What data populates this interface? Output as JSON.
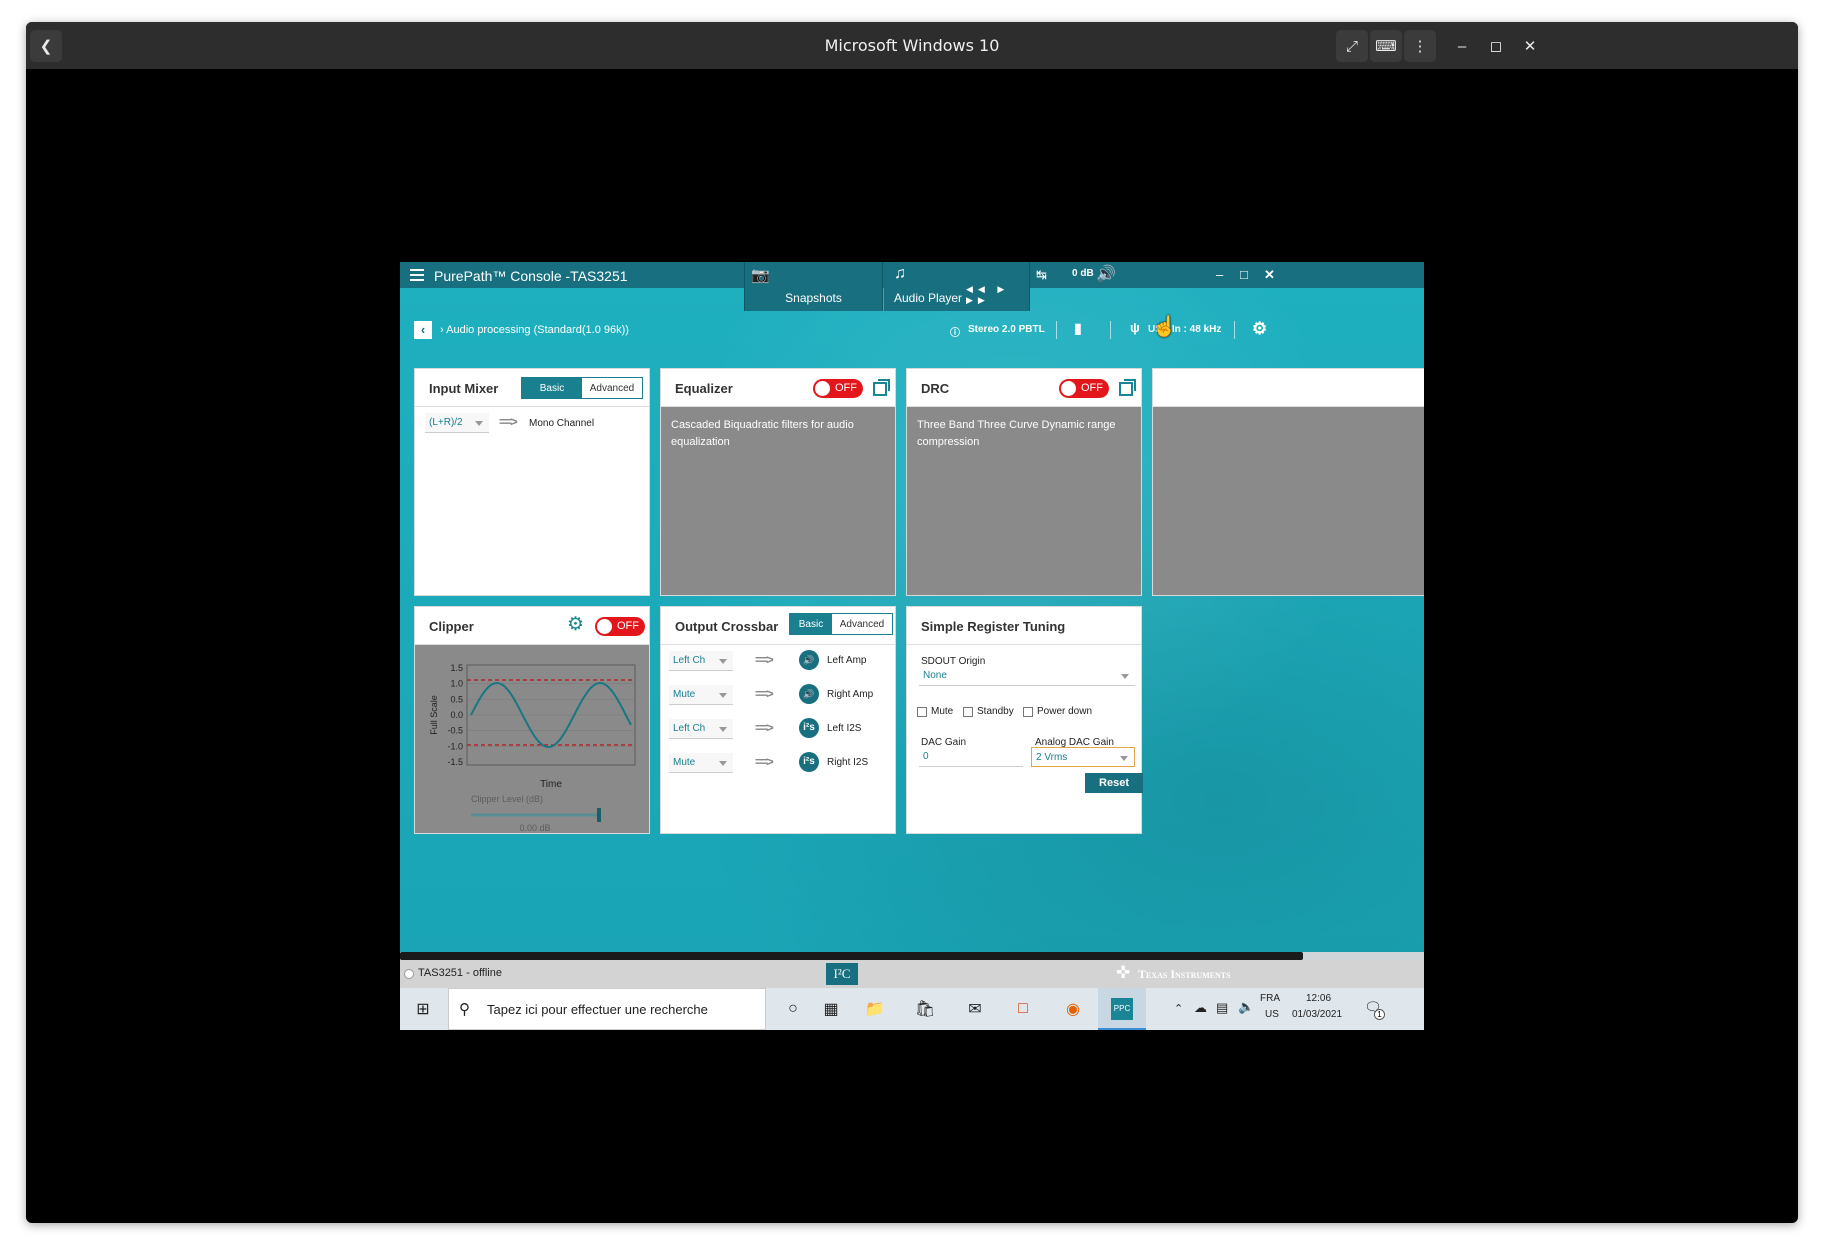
{
  "vm": {
    "title": "Microsoft Windows 10"
  },
  "app": {
    "title": "PurePath™ Console -TAS3251",
    "tabs": {
      "snapshots": "Snapshots",
      "audio_player": "Audio Player"
    },
    "volume": "0 dB",
    "breadcrumb": "Audio processing (Standard(1.0 96k))",
    "status": {
      "mode": "Stereo 2.0 PBTL",
      "usb": "USB In : 48 kHz"
    }
  },
  "input_mixer": {
    "title": "Input Mixer",
    "seg_basic": "Basic",
    "seg_advanced": "Advanced",
    "source": "(L+R)/2",
    "dest": "Mono Channel"
  },
  "equalizer": {
    "title": "Equalizer",
    "toggle": "OFF",
    "description": "Cascaded Biquadratic filters for audio equalization"
  },
  "drc": {
    "title": "DRC",
    "toggle": "OFF",
    "description": "Three Band Three Curve Dynamic range compression"
  },
  "clipper": {
    "title": "Clipper",
    "toggle": "OFF",
    "ylabel": "Full Scale",
    "xlabel": "Time",
    "yticks": [
      "1.5",
      "1.0",
      "0.5",
      "0.0",
      "-0.5",
      "-1.0",
      "-1.5"
    ],
    "level_label": "Clipper Level (dB)",
    "level_value": "0.00 dB",
    "slider_fraction": 1.0
  },
  "crossbar": {
    "title": "Output Crossbar",
    "seg_basic": "Basic",
    "seg_advanced": "Advanced",
    "rows": [
      {
        "source": "Left Ch",
        "dest": "Left Amp",
        "icon": "speaker-icon"
      },
      {
        "source": "Mute",
        "dest": "Right Amp",
        "icon": "speaker-icon"
      },
      {
        "source": "Left Ch",
        "dest": "Left I2S",
        "icon": "i2s-icon"
      },
      {
        "source": "Mute",
        "dest": "Right I2S",
        "icon": "i2s-icon"
      }
    ]
  },
  "register_tuning": {
    "title": "Simple Register Tuning",
    "sdout_label": "SDOUT Origin",
    "sdout_value": "None",
    "mute": "Mute",
    "standby": "Standby",
    "power_down": "Power down",
    "dac_gain_label": "DAC Gain",
    "dac_gain_value": "0",
    "analog_gain_label": "Analog DAC Gain",
    "analog_gain_value": "2 Vrms",
    "reset": "Reset"
  },
  "statusbar": {
    "device": "TAS3251 - offline",
    "bus": "I²C",
    "brand": "Texas Instruments"
  },
  "taskbar": {
    "search_placeholder": "Tapez ici pour effectuer une recherche",
    "lang1": "FRA",
    "lang2": "US",
    "time": "12:06",
    "date": "01/03/2021",
    "notification_count": "1"
  }
}
